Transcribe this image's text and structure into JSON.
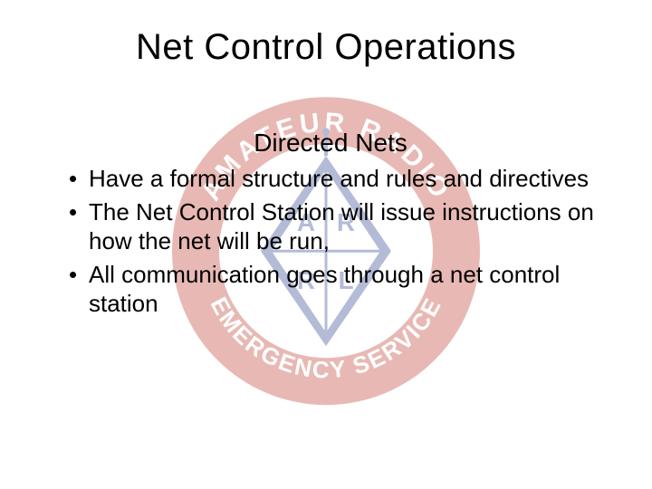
{
  "slide": {
    "title": "Net Control Operations",
    "subtitle": "Directed Nets",
    "bullets": [
      "Have a formal structure and rules and directives",
      "The Net Control Station will issue instructions on how the net will be run,",
      "All communication goes through a net control station"
    ],
    "logo": {
      "outer_text_top": "AMATEUR RADIO",
      "outer_text_bottom": "EMERGENCY SERVICE",
      "diamond_letters": [
        "A",
        "R",
        "R",
        "L"
      ],
      "colors": {
        "ring": "#c0392b",
        "diamond": "#2c3e8f",
        "diamond_fill": "#ffffff",
        "text": "#ffffff"
      }
    }
  }
}
